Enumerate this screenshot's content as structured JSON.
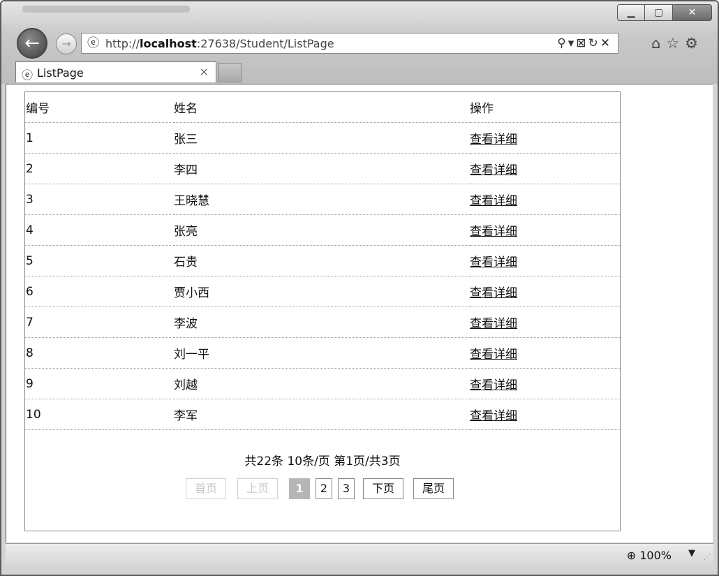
{
  "browser": {
    "url_prefix": "http://",
    "url_host": "localhost",
    "url_rest": ":27638/Student/ListPage",
    "tab_title": "ListPage",
    "tab_close": "×",
    "zoom": "100%"
  },
  "table": {
    "headers": [
      "编号",
      "姓名",
      "操作"
    ],
    "rows": [
      {
        "id": "1",
        "name": "张三",
        "action": "查看详细"
      },
      {
        "id": "2",
        "name": "李四",
        "action": "查看详细"
      },
      {
        "id": "3",
        "name": "王晓慧",
        "action": "查看详细"
      },
      {
        "id": "4",
        "name": "张亮",
        "action": "查看详细"
      },
      {
        "id": "5",
        "name": "石贵",
        "action": "查看详细"
      },
      {
        "id": "6",
        "name": "贾小西",
        "action": "查看详细"
      },
      {
        "id": "7",
        "name": "李波",
        "action": "查看详细"
      },
      {
        "id": "8",
        "name": "刘一平",
        "action": "查看详细"
      },
      {
        "id": "9",
        "name": "刘越",
        "action": "查看详细"
      },
      {
        "id": "10",
        "name": "李军",
        "action": "查看详细"
      }
    ]
  },
  "pagination": {
    "summary": "共22条 10条/页 第1页/共3页",
    "first": "首页",
    "prev": "上页",
    "pages": [
      "1",
      "2",
      "3"
    ],
    "current_page": "1",
    "next": "下页",
    "last": "尾页"
  }
}
